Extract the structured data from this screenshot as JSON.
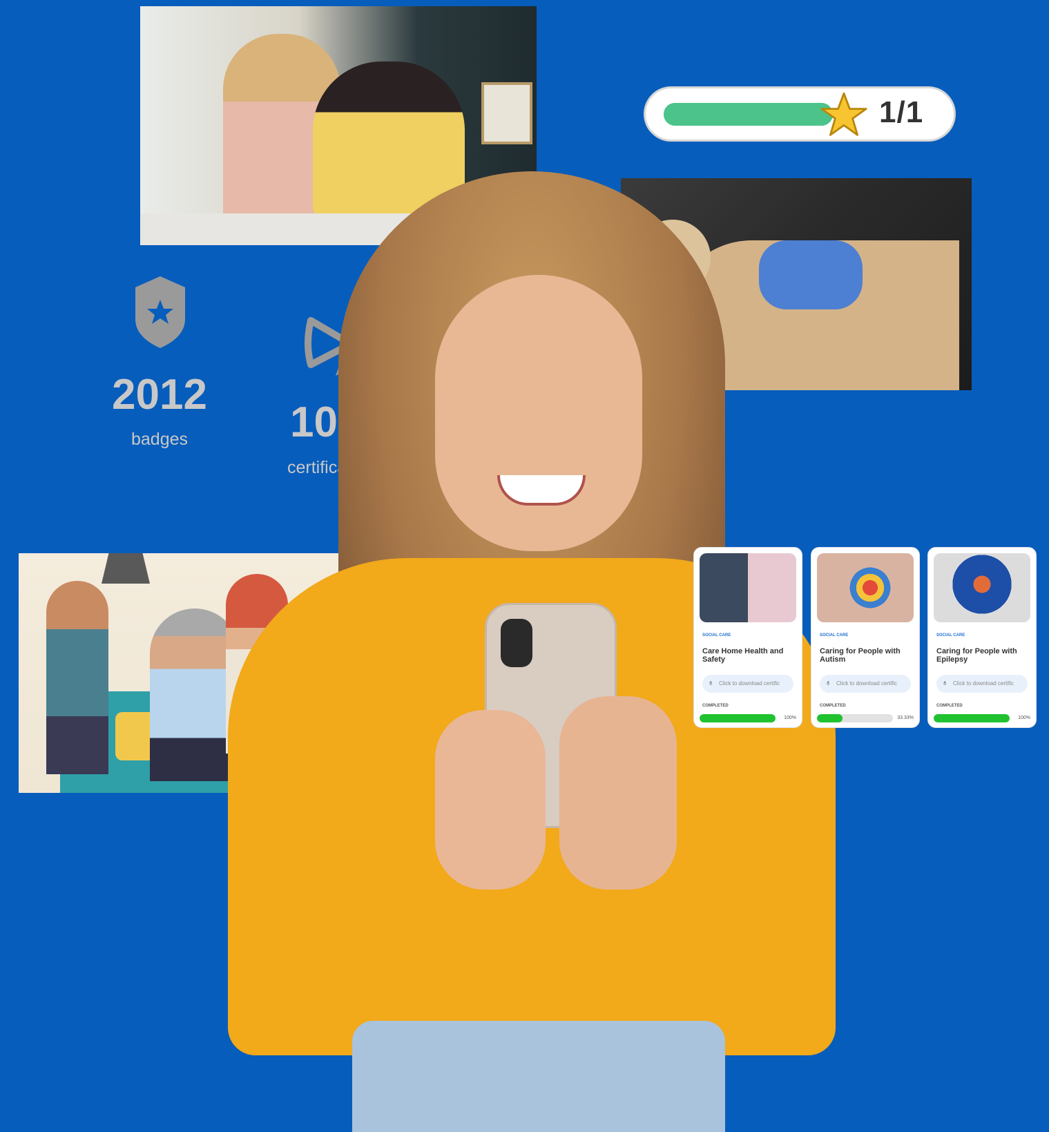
{
  "progress": {
    "label": "1/1",
    "fraction": 1.0,
    "accent": "#4cc38a",
    "icon": "star-icon"
  },
  "stats": {
    "badges": {
      "value": "2012",
      "label": "badges",
      "icon": "shield-star-icon"
    },
    "certifications": {
      "value": "1062",
      "label": "certifications",
      "icon": "ribbon-bow-icon"
    }
  },
  "courses": [
    {
      "category": "SOCIAL CARE",
      "title": "Care Home Health and Safety",
      "download": "Click to download certific",
      "status": "COMPLETED",
      "percent_text": "100%",
      "percent": 100
    },
    {
      "category": "SOCIAL CARE",
      "title": "Caring for People with Autism",
      "download": "Click to download certific",
      "status": "COMPLETED",
      "percent_text": "33.33%",
      "percent": 33.33
    },
    {
      "category": "SOCIAL CARE",
      "title": "Caring for People with Epilepsy",
      "download": "Click to download certific",
      "status": "COMPLETED",
      "percent_text": "100%",
      "percent": 100
    }
  ],
  "colors": {
    "background": "#075dbb",
    "progress_green": "#20c22f",
    "stat_text": "#c8c8c8"
  }
}
